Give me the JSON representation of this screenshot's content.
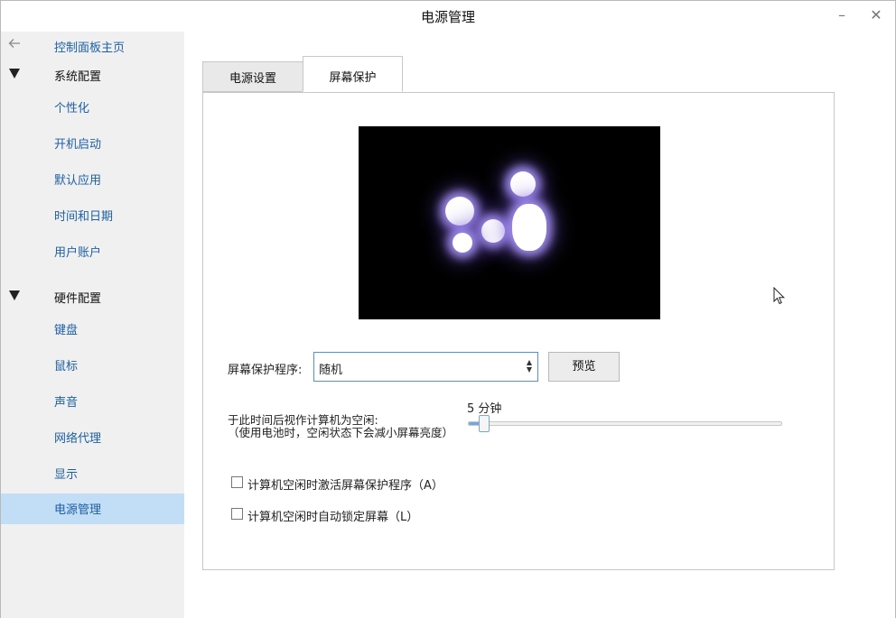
{
  "window": {
    "title": "电源管理",
    "minimize_label": "–",
    "close_label": "✕"
  },
  "sidebar": {
    "back_label": "控制面板主页",
    "group1": "系统配置",
    "group1_items": [
      "个性化",
      "开机启动",
      "默认应用",
      "时间和日期",
      "用户账户"
    ],
    "group2": "硬件配置",
    "group2_items": [
      "键盘",
      "鼠标",
      "声音",
      "网络代理",
      "显示",
      "电源管理"
    ],
    "active_item": "电源管理"
  },
  "tabs": {
    "power": "电源设置",
    "screensaver": "屏幕保护",
    "active": "屏幕保护"
  },
  "screensaver": {
    "program_label": "屏幕保护程序:",
    "program_value": "随机",
    "preview_button": "预览",
    "idle_label_line1": "于此时间后视作计算机为空闲:",
    "idle_label_line2": "（使用电池时，空闲状态下会减小屏幕亮度）",
    "idle_value": "5 分钟",
    "idle_level_fraction": 0.04,
    "activate_label": "计算机空闲时激活屏幕保护程序（A）",
    "activate_checked": false,
    "lock_label": "计算机空闲时自动锁定屏幕（L）",
    "lock_checked": false
  },
  "colors": {
    "accent": "#1d5fa6",
    "active_bg": "#c2ddf6",
    "sidebar_bg": "#f0f0f0",
    "slider_fill": "#6ea9dc"
  },
  "icons": {
    "back": "arrow-left-icon",
    "collapse": "triangle-down-icon",
    "cursor": "mouse-pointer-icon"
  }
}
